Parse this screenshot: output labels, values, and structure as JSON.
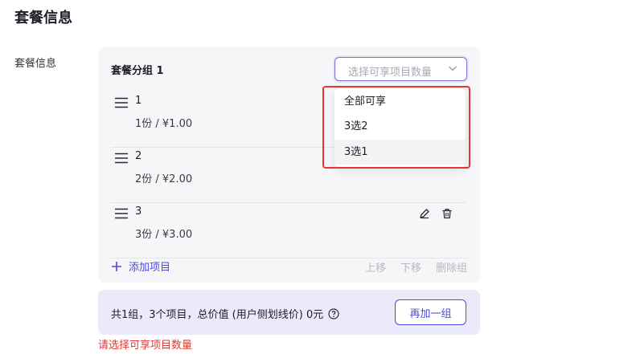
{
  "page": {
    "title": "套餐信息"
  },
  "form": {
    "label": "套餐信息"
  },
  "group": {
    "title": "套餐分组 1",
    "select_placeholder": "选择可享项目数量",
    "items": [
      {
        "name": "1",
        "price": "1份 / ¥1.00"
      },
      {
        "name": "2",
        "price": "2份 / ¥2.00"
      },
      {
        "name": "3",
        "price": "3份 / ¥3.00"
      }
    ],
    "add_item_label": "添加项目",
    "move_up_label": "上移",
    "move_down_label": "下移",
    "delete_group_label": "删除组"
  },
  "dropdown": {
    "options": [
      "全部可享",
      "3选2",
      "3选1"
    ],
    "hovered_index": 2
  },
  "summary": {
    "text": "共1组，3个项目，总价值 (用户侧划线价) 0元",
    "add_group_label": "再加一组"
  },
  "validation": {
    "error": "请选择可享项目数量"
  },
  "colors": {
    "accent": "#4a4adb",
    "error": "#e5362f",
    "summary_bg": "#ece9fb",
    "card_bg": "#f6f6f8"
  },
  "icons": {
    "drag": "drag-handle-icon",
    "edit": "edit-icon",
    "delete": "trash-icon",
    "add": "plus-icon",
    "help": "help-circle-icon",
    "chevron": "chevron-down-icon"
  }
}
